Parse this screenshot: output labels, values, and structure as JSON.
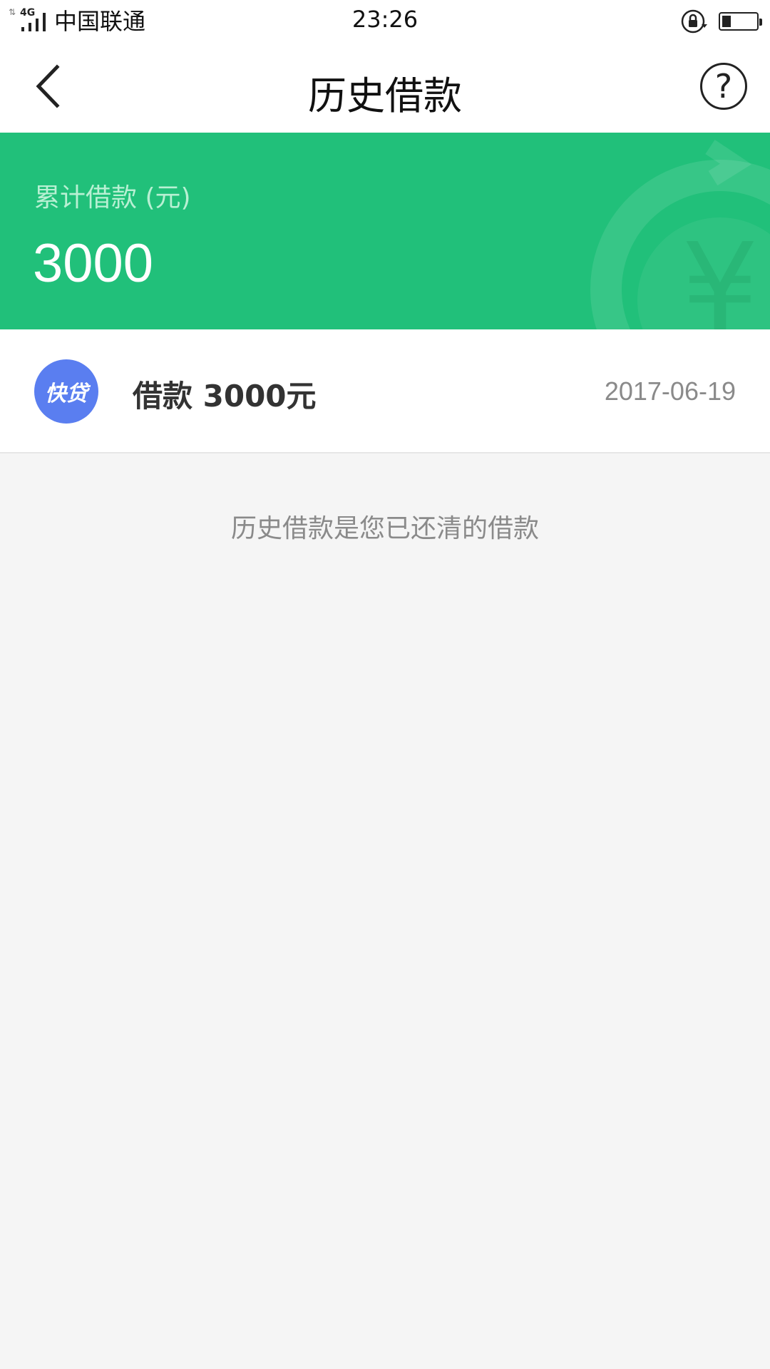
{
  "status_bar": {
    "network_label": "4G",
    "transfer_arrows": "⇅",
    "carrier": "中国联通",
    "time": "23:26",
    "battery_percent": 25
  },
  "header": {
    "title": "历史借款",
    "help_symbol": "?"
  },
  "summary": {
    "label": "累计借款 (元)",
    "amount": "3000",
    "currency_symbol": "¥"
  },
  "loans": [
    {
      "logo_text": "快贷",
      "title": "借款 3000元",
      "date": "2017-06-19"
    }
  ],
  "footer_hint": "历史借款是您已还清的借款",
  "colors": {
    "brand_green": "#21c07a",
    "logo_blue": "#5a7ef0"
  },
  "icons": {
    "back": "chevron-left-icon",
    "help": "question-circle-icon",
    "lock_rotation": "rotation-lock-icon",
    "battery": "battery-icon"
  }
}
